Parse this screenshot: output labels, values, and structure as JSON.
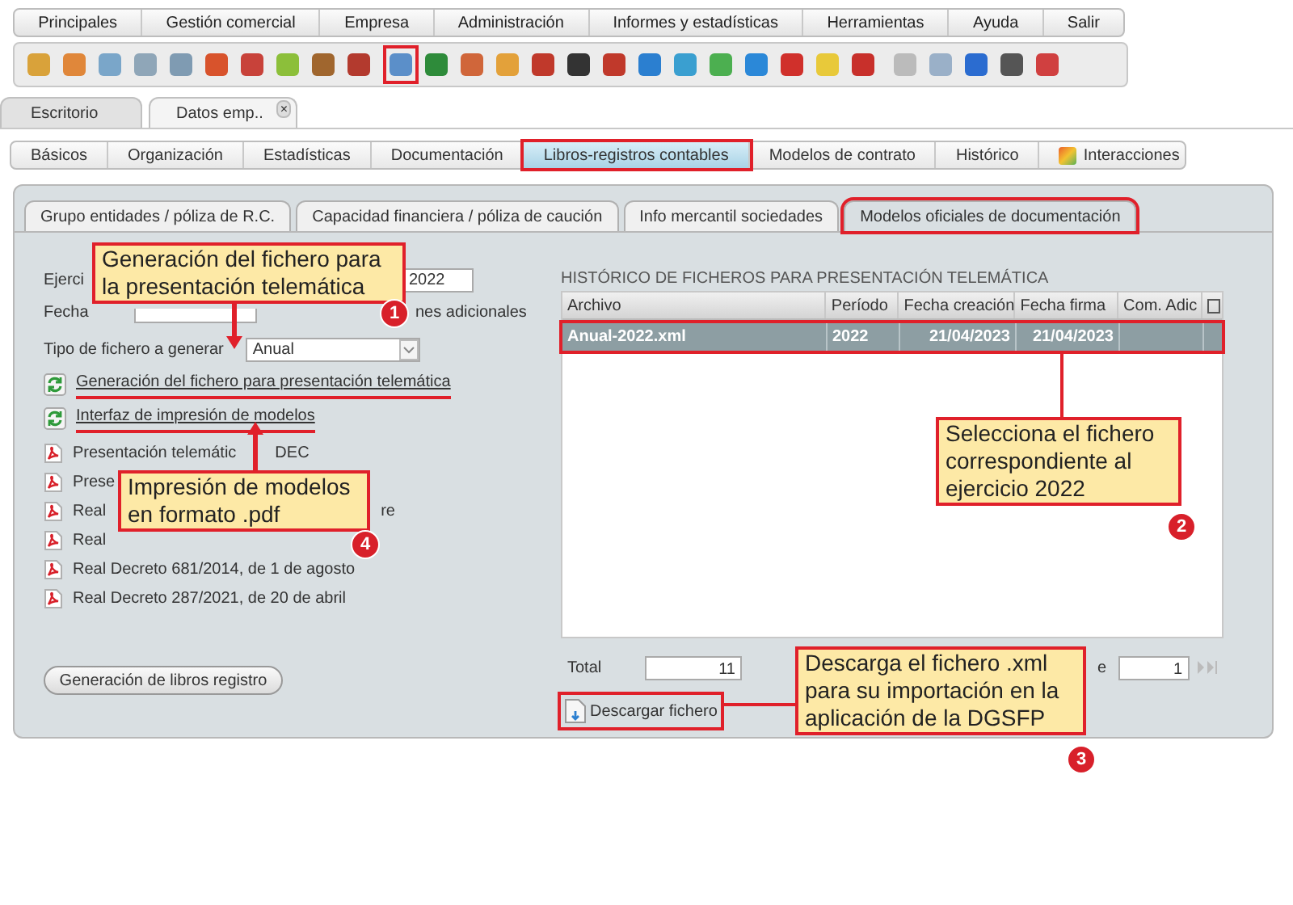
{
  "menu": [
    {
      "label": "Principales"
    },
    {
      "label": "Gestión comercial"
    },
    {
      "label": "Empresa"
    },
    {
      "label": "Administración"
    },
    {
      "label": "Informes y estadísticas"
    },
    {
      "label": "Herramientas"
    },
    {
      "label": "Ayuda"
    },
    {
      "label": "Salir"
    }
  ],
  "toolbar": {
    "icons": [
      {
        "highlighted": false
      },
      {
        "highlighted": false
      },
      {
        "highlighted": false
      },
      {
        "highlighted": false
      },
      {
        "highlighted": false
      },
      {
        "highlighted": false
      },
      {
        "highlighted": false
      },
      {
        "highlighted": false
      },
      {
        "highlighted": false
      },
      {
        "highlighted": false
      },
      {
        "highlighted": true
      },
      {
        "highlighted": false
      },
      {
        "highlighted": false
      },
      {
        "highlighted": false
      },
      {
        "highlighted": false
      },
      {
        "highlighted": false
      },
      {
        "highlighted": false
      },
      {
        "highlighted": false
      },
      {
        "highlighted": false
      },
      {
        "highlighted": false
      },
      {
        "highlighted": false
      },
      {
        "highlighted": false
      },
      {
        "highlighted": false
      },
      {
        "highlighted": false
      },
      {
        "highlighted": false
      },
      {
        "highlighted": false
      },
      {
        "highlighted": false
      },
      {
        "highlighted": false
      },
      {
        "highlighted": false
      }
    ]
  },
  "window_tabs": [
    {
      "label": "Escritorio",
      "selected": false
    },
    {
      "label": "Datos emp..",
      "selected": true,
      "close": "×"
    }
  ],
  "sub_tabs": [
    {
      "label": "Básicos",
      "selected": false,
      "highlighted": false
    },
    {
      "label": "Organización",
      "selected": false,
      "highlighted": false
    },
    {
      "label": "Estadísticas",
      "selected": false,
      "highlighted": false
    },
    {
      "label": "Documentación",
      "selected": false,
      "highlighted": false
    },
    {
      "label": "Libros-registros contables",
      "selected": true,
      "highlighted": true
    },
    {
      "label": "Modelos de contrato",
      "selected": false,
      "highlighted": false
    },
    {
      "label": "Histórico",
      "selected": false,
      "highlighted": false
    },
    {
      "label": "Interacciones",
      "selected": false,
      "highlighted": false,
      "icon": true
    }
  ],
  "section_tabs": [
    {
      "label": "Grupo entidades / póliza de R.C.",
      "selected": false,
      "highlighted": false
    },
    {
      "label": "Capacidad financiera / póliza de caución",
      "selected": false,
      "highlighted": false
    },
    {
      "label": "Info mercantil sociedades",
      "selected": false,
      "highlighted": false
    },
    {
      "label": "Modelos oficiales de documentación",
      "selected": true,
      "highlighted": true
    }
  ],
  "form": {
    "year_label": "Ejerci",
    "year_value": "2022",
    "date_label": "Fecha",
    "date_tail": "nes adicionales",
    "type_label": "Tipo de fichero a generar",
    "type_value": "Anual"
  },
  "links": [
    {
      "label": "Generación del fichero para presentación telemática",
      "underlined": true
    },
    {
      "label": "Interfaz de impresión de modelos",
      "underlined": true
    }
  ],
  "documents": [
    {
      "kind": "arrow-gap",
      "text": "Presentación telemátic",
      "tail": "DEC"
    },
    {
      "kind": "plain",
      "text": "Prese"
    },
    {
      "kind": "callout-gap",
      "text": "Real",
      "tail": "re"
    },
    {
      "kind": "plain",
      "text": "Real"
    },
    {
      "kind": "plain",
      "text": "Real Decreto 681/2014, de 1 de agosto"
    },
    {
      "kind": "plain",
      "text": "Real Decreto 287/2021, de 20 de abril"
    }
  ],
  "books_button": "Generación de libros registro",
  "history": {
    "title": "HISTÓRICO DE FICHEROS PARA PRESENTACIÓN TELEMÁTICA",
    "columns": [
      "Archivo",
      "Período",
      "Fecha creación",
      "Fecha firma",
      "Com. Adic"
    ],
    "rows": [
      {
        "cells": [
          "Anual-2022.xml",
          "2022",
          "21/04/2023",
          "21/04/2023",
          ""
        ],
        "selected": true,
        "highlighted": true
      }
    ],
    "total_label": "Total",
    "total_value": "11",
    "page_label": "e",
    "page_value": "1",
    "download": {
      "label": "Descargar fichero",
      "highlighted": true
    }
  },
  "callouts": [
    {
      "text": "Generación del fichero para la presentación telemática",
      "number": "1"
    },
    {
      "text": "Selecciona el fichero correspondiente al ejercicio 2022",
      "number": "2"
    },
    {
      "text": "Descarga el fichero .xml para su importación en la aplicación de la DGSFP",
      "number": "3"
    },
    {
      "text": "Impresión de modelos en formato .pdf",
      "number": "4"
    }
  ]
}
